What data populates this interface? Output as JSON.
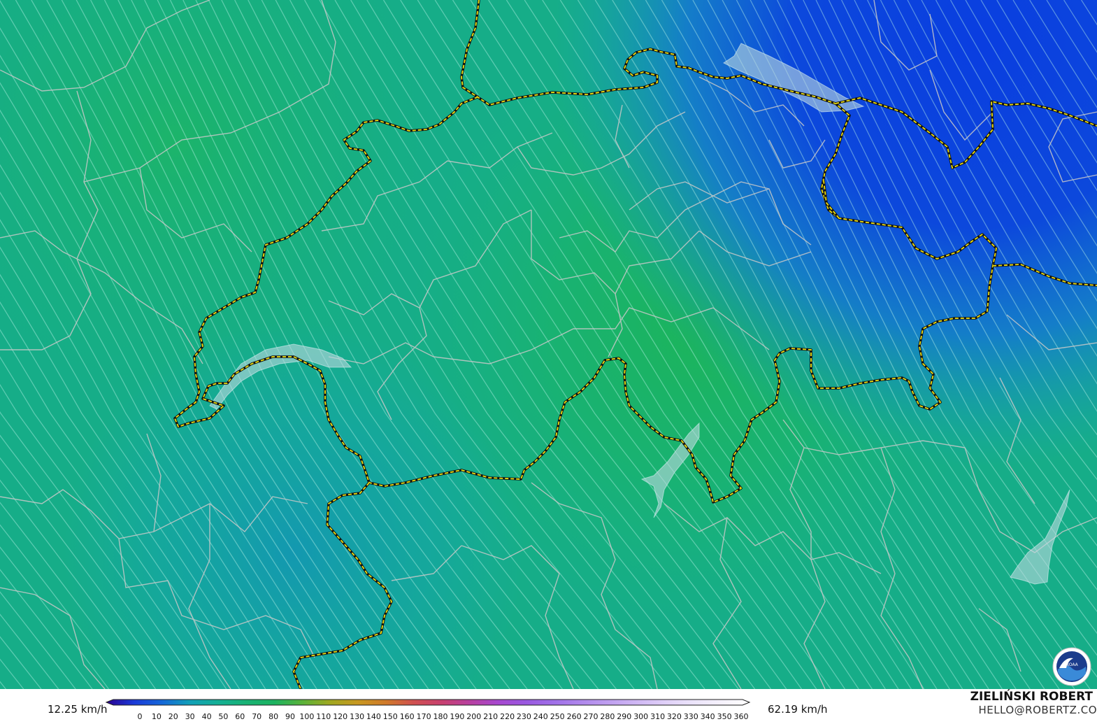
{
  "map": {
    "type": "wind-speed-streamlines",
    "background_colors": {
      "deep_blue": "#0a44dc",
      "blue": "#1a66dd",
      "teal": "#14a8a8",
      "green": "#18b37a",
      "bright_green": "#1cb560",
      "border_line": "#111111",
      "border_dash": "#f0e010",
      "region_line": "#c8c8c8",
      "lake": "#b8d8e0"
    },
    "icon": "noaa-logo"
  },
  "legend": {
    "min_label": "12.25 km/h",
    "max_label": "62.19 km/h",
    "ticks": [
      "0",
      "10",
      "20",
      "30",
      "40",
      "50",
      "60",
      "70",
      "80",
      "90",
      "100",
      "110",
      "120",
      "130",
      "140",
      "150",
      "160",
      "170",
      "180",
      "190",
      "200",
      "210",
      "220",
      "230",
      "240",
      "250",
      "260",
      "270",
      "280",
      "290",
      "300",
      "310",
      "320",
      "330",
      "340",
      "350",
      "360"
    ],
    "colors": [
      "#2a0090",
      "#1a3ad8",
      "#1468d8",
      "#12a0b8",
      "#14b095",
      "#18b275",
      "#1cb360",
      "#58b23a",
      "#a0a820",
      "#c89820",
      "#d07a2a",
      "#d05050",
      "#c84070",
      "#b840a0",
      "#a848d0",
      "#9a58e0",
      "#a070e8",
      "#b088ec",
      "#c0a0f0",
      "#d0b8f4",
      "#e0d0f8",
      "#ece4fa",
      "#f6f2fc",
      "#ffffff"
    ]
  },
  "credit": {
    "name": "ZIELIŃSKI ROBERT",
    "email": "HELLO@ROBERTZ.CO"
  }
}
